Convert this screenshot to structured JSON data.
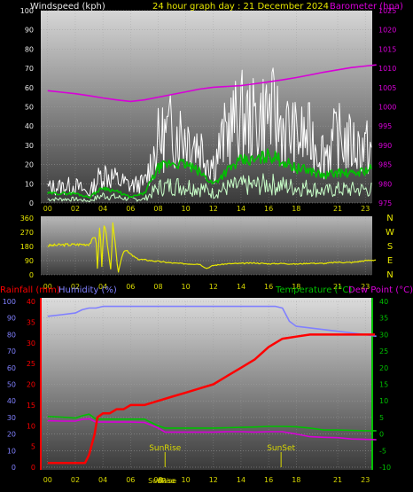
{
  "chart_data": [
    {
      "type": "line",
      "title": "24 hour graph day : 21 December 2024",
      "left_axis_label": "Windspeed (kph)",
      "right_axis_label": "Barometer (hpa)",
      "x_ticks": [
        "00",
        "02",
        "04",
        "06",
        "08",
        "10",
        "12",
        "14",
        "16",
        "18",
        "21",
        "23"
      ],
      "y_left_ticks": [
        0,
        10,
        20,
        30,
        40,
        50,
        60,
        70,
        80,
        90,
        100
      ],
      "y_right_ticks": [
        975,
        980,
        985,
        990,
        995,
        1000,
        1005,
        1010,
        1015,
        1020,
        1025
      ],
      "ylim_left": [
        0,
        100
      ],
      "ylim_right": [
        975,
        1025
      ],
      "colors": {
        "barometer": "#d800d8",
        "gust": "#ffffff",
        "average": "#00c000",
        "wind_band": "#c8ffc8"
      },
      "series": [
        {
          "key": "gust",
          "hours": [
            0,
            2,
            3,
            4,
            5,
            6,
            7,
            8,
            9,
            10,
            11,
            12,
            13,
            14,
            15,
            16,
            17,
            18,
            19,
            20,
            21,
            22,
            23.5
          ],
          "values": [
            8,
            9,
            5,
            16,
            12,
            9,
            10,
            32,
            38,
            36,
            30,
            20,
            38,
            45,
            42,
            48,
            40,
            34,
            34,
            26,
            34,
            30,
            28
          ]
        },
        {
          "key": "average",
          "hours": [
            0,
            2,
            3,
            4,
            5,
            6,
            7,
            8,
            9,
            10,
            11,
            12,
            13,
            14,
            15,
            16,
            17,
            18,
            19,
            20,
            21,
            22,
            23.5
          ],
          "values": [
            5,
            5,
            3,
            8,
            6,
            3,
            5,
            18,
            21,
            20,
            16,
            10,
            17,
            22,
            22,
            25,
            22,
            18,
            17,
            14,
            16,
            15,
            18
          ]
        },
        {
          "key": "wind_band",
          "hours": [
            0,
            2,
            3,
            4,
            5,
            6,
            7,
            8,
            9,
            10,
            11,
            12,
            13,
            14,
            15,
            16,
            17,
            18,
            19,
            20,
            21,
            22,
            23.5
          ],
          "values": [
            2,
            2,
            1,
            4,
            3,
            2,
            2,
            8,
            9,
            9,
            8,
            5,
            8,
            9,
            9,
            10,
            9,
            8,
            8,
            6,
            7,
            7,
            7
          ]
        },
        {
          "key": "barometer",
          "hours": [
            0,
            1,
            2,
            3,
            4,
            5,
            6,
            7,
            8,
            9,
            10,
            11,
            12,
            13,
            14,
            15,
            16,
            17,
            18,
            19,
            20,
            21,
            22,
            23,
            23.8
          ],
          "values": [
            1004.2,
            1003.8,
            1003.4,
            1002.9,
            1002.3,
            1001.8,
            1001.4,
            1001.8,
            1002.5,
            1003.2,
            1003.9,
            1004.6,
            1005.1,
            1005.3,
            1005.5,
            1006.0,
            1006.5,
            1007.0,
            1007.6,
            1008.3,
            1009.0,
            1009.6,
            1010.2,
            1010.6,
            1010.9
          ]
        }
      ]
    },
    {
      "type": "line",
      "y_ticks": [
        0,
        90,
        180,
        270,
        360
      ],
      "ylim": [
        0,
        360
      ],
      "compass_labels": [
        "N",
        "W",
        "S",
        "E",
        "N"
      ],
      "color": "#e8e800",
      "series": [
        {
          "key": "direction",
          "hours": [
            0,
            1,
            2,
            3,
            3.5,
            3.6,
            3.8,
            3.9,
            4.1,
            4.3,
            4.6,
            4.7,
            5.1,
            5.4,
            5.6,
            6.0,
            6.5,
            7,
            8,
            9,
            10,
            11,
            11.5,
            12,
            13,
            14,
            15,
            16,
            17,
            18,
            19,
            20,
            21,
            22,
            23,
            23.8
          ],
          "values": [
            185,
            190,
            192,
            195,
            250,
            40,
            355,
            20,
            360,
            200,
            10,
            360,
            10,
            130,
            160,
            130,
            100,
            95,
            85,
            75,
            70,
            68,
            40,
            60,
            70,
            72,
            75,
            70,
            72,
            68,
            74,
            72,
            80,
            78,
            90,
            95
          ]
        }
      ]
    },
    {
      "type": "line",
      "left_labels": {
        "rainfall": "Rainfall (mm)",
        "humidity": "Humidity (%)"
      },
      "right_labels": {
        "temperature": "Temperature (°C)",
        "dew_point": "Dew Point (°C)"
      },
      "y_left_ticks": [
        0,
        10,
        20,
        30,
        40,
        50,
        60,
        70,
        80,
        90,
        100
      ],
      "y_right_ticks": [
        -10,
        -5,
        0,
        5,
        10,
        15,
        20,
        25,
        30,
        35,
        40
      ],
      "ylim_left": [
        0,
        100
      ],
      "ylim_right": [
        -10,
        40
      ],
      "rain_y_ticks": [
        0,
        5,
        10,
        15,
        20,
        25,
        30,
        35,
        40
      ],
      "events": [
        {
          "label": "SunRise",
          "hour": 8.5
        },
        {
          "label": "SunSet",
          "hour": 16.9
        }
      ],
      "bottom_markers": [
        {
          "label": "SunRise",
          "hour": 8.3
        },
        {
          "label": "Base",
          "hour": 8.6
        }
      ],
      "colors": {
        "rainfall": "#ff0000",
        "humidity": "#8080ff",
        "temperature": "#00c000",
        "dew_point": "#d800d8",
        "events": "#d8d800"
      },
      "series": [
        {
          "key": "humidity",
          "hours": [
            0,
            1,
            2,
            2.5,
            3,
            3.5,
            4,
            5,
            6,
            7,
            8,
            9,
            10,
            11,
            12,
            13,
            14,
            15,
            16,
            16.5,
            17,
            17.5,
            18,
            19,
            20,
            21,
            22,
            23,
            23.8
          ],
          "values": [
            91,
            92,
            93,
            95,
            96,
            96,
            97,
            97,
            97,
            97,
            97,
            97,
            97,
            97,
            97,
            97,
            97,
            97,
            97,
            97,
            96,
            88,
            85,
            84,
            83,
            82,
            81,
            80,
            79
          ]
        },
        {
          "key": "temperature",
          "hours": [
            0,
            1,
            2,
            2.5,
            3,
            3.5,
            4,
            5,
            6,
            7,
            8,
            8.5,
            9,
            10,
            11,
            12,
            13,
            14,
            15,
            16,
            17,
            18,
            19,
            20,
            21,
            22,
            23,
            23.8
          ],
          "values": [
            5.3,
            5.1,
            4.8,
            5.5,
            6.0,
            4.5,
            4.5,
            4.5,
            4.5,
            4.5,
            2.5,
            1.8,
            1.8,
            1.8,
            1.8,
            1.8,
            1.9,
            2.0,
            2.1,
            2.3,
            2.3,
            2.2,
            1.8,
            1.2,
            1.2,
            1.1,
            1.0,
            1.0
          ]
        },
        {
          "key": "dew_point",
          "hours": [
            0,
            1,
            2,
            2.5,
            3,
            3.5,
            4,
            5,
            6,
            7,
            8,
            8.5,
            9,
            10,
            11,
            12,
            13,
            14,
            15,
            16,
            17,
            18,
            19,
            20,
            21,
            22,
            23,
            23.8
          ],
          "values": [
            4.0,
            3.9,
            3.9,
            4.4,
            4.6,
            3.6,
            3.6,
            3.6,
            3.6,
            3.5,
            1.8,
            0.6,
            0.6,
            0.6,
            0.6,
            0.6,
            0.7,
            0.7,
            0.6,
            0.7,
            0.7,
            0.0,
            -0.8,
            -1.0,
            -1.1,
            -1.5,
            -1.6,
            -1.7
          ]
        },
        {
          "key": "rainfall",
          "hours": [
            0,
            1,
            2,
            2.7,
            3,
            3.4,
            3.6,
            4,
            4.5,
            5,
            5.5,
            6,
            7,
            8,
            9,
            10,
            11,
            12,
            13,
            14,
            15,
            16,
            17,
            18,
            19,
            20,
            21,
            22,
            23,
            23.7
          ],
          "values": [
            1,
            1,
            1,
            1,
            3,
            8,
            12,
            13,
            13,
            14,
            14,
            15,
            15,
            16,
            17,
            18,
            19,
            20,
            22,
            24,
            26,
            29,
            31,
            31.5,
            32,
            32,
            32,
            32,
            32,
            32
          ]
        }
      ]
    }
  ]
}
